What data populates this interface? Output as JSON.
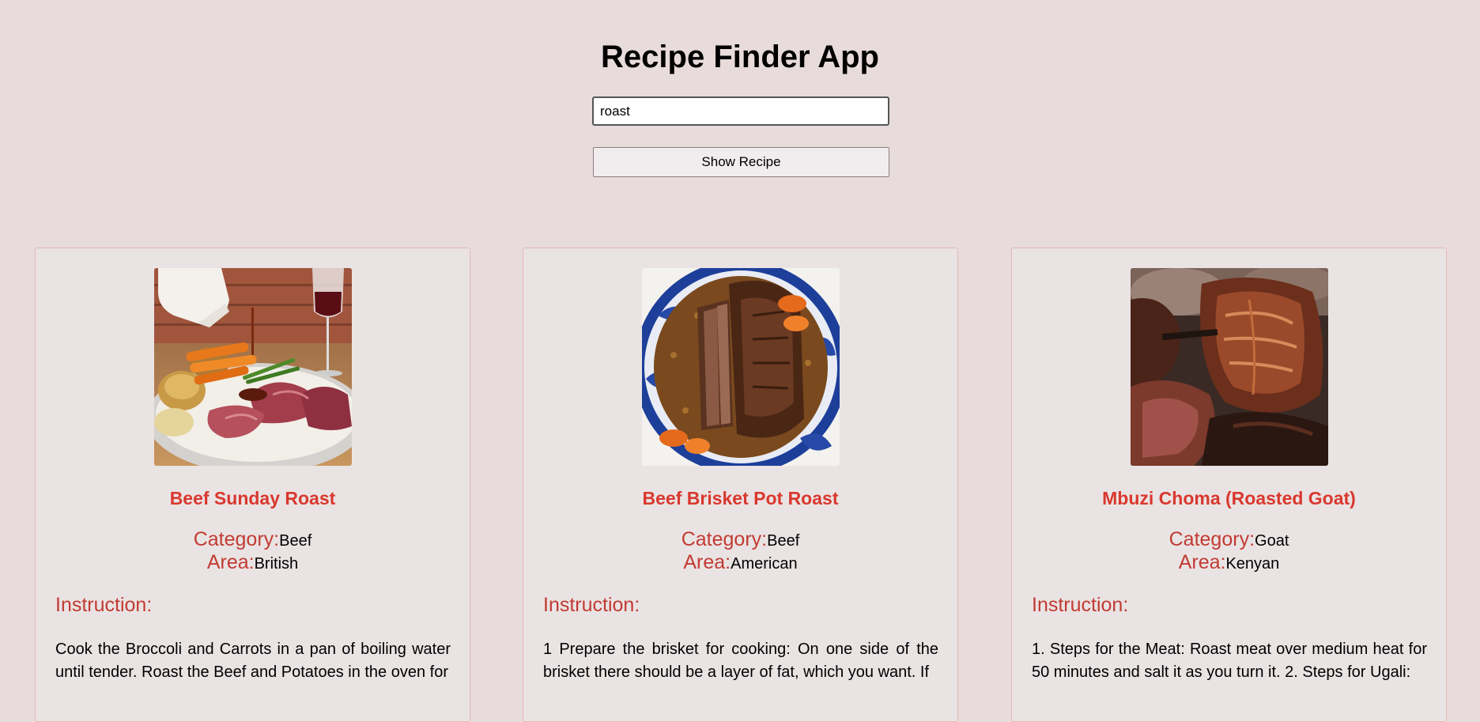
{
  "app": {
    "title": "Recipe Finder App"
  },
  "search": {
    "value": "roast",
    "button_label": "Show Recipe"
  },
  "labels": {
    "category": "Category:",
    "area": "Area:",
    "instruction": "Instruction:"
  },
  "recipes": [
    {
      "name": "Beef Sunday Roast",
      "category": "Beef",
      "area": "British",
      "image": "beef-sunday-roast-photo",
      "instructions": "Cook the Broccoli and Carrots in a pan of boiling water until tender. Roast the Beef and Potatoes in the oven for"
    },
    {
      "name": "Beef Brisket Pot Roast",
      "category": "Beef",
      "area": "American",
      "image": "beef-brisket-pot-roast-photo",
      "instructions": "1 Prepare the brisket for cooking: On one side of the brisket there should be a layer of fat, which you want. If"
    },
    {
      "name": "Mbuzi Choma (Roasted Goat)",
      "category": "Goat",
      "area": "Kenyan",
      "image": "mbuzi-choma-photo",
      "instructions": "1. Steps for the Meat: Roast meat over medium heat for 50 minutes and salt it as you turn it. 2. Steps for Ugali:"
    }
  ],
  "colors": {
    "background": "#e8dbdc",
    "card_background": "#eae3e3",
    "card_border": "#e3b7b9",
    "recipe_title": "#d9382f",
    "label": "#c13b33"
  }
}
